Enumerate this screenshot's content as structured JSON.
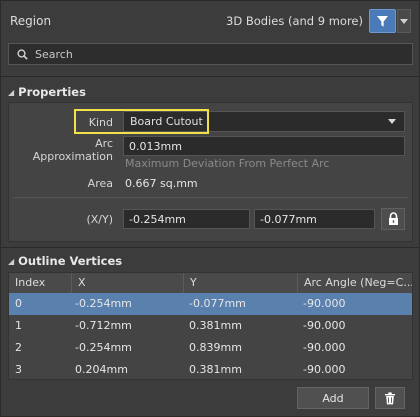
{
  "header": {
    "title": "Region",
    "filter_text": "3D Bodies (and 9 more)",
    "filter_icon": "funnel-icon",
    "filter_dropdown_icon": "chevron-down-icon"
  },
  "search": {
    "placeholder": "Search",
    "value": ""
  },
  "properties": {
    "section_title": "Properties",
    "kind_label": "Kind",
    "kind_value": "Board Cutout",
    "arc_label_line1": "Arc",
    "arc_label_line2": "Approximation",
    "arc_value": "0.013mm",
    "arc_hint": "Maximum Deviation From Perfect Arc",
    "area_label": "Area",
    "area_value": "0.667 sq.mm",
    "xy_label": "(X/Y)",
    "x_value": "-0.254mm",
    "y_value": "-0.077mm",
    "lock_icon": "lock-icon"
  },
  "outline": {
    "section_title": "Outline Vertices",
    "columns": [
      "Index",
      "X",
      "Y",
      "Arc Angle (Neg=C..."
    ],
    "rows": [
      {
        "index": "0",
        "x": "-0.254mm",
        "y": "-0.077mm",
        "arc": "-90.000",
        "selected": true
      },
      {
        "index": "1",
        "x": "-0.712mm",
        "y": "0.381mm",
        "arc": "-90.000",
        "selected": false
      },
      {
        "index": "2",
        "x": "-0.254mm",
        "y": "0.839mm",
        "arc": "-90.000",
        "selected": false
      },
      {
        "index": "3",
        "x": "0.204mm",
        "y": "0.381mm",
        "arc": "-90.000",
        "selected": false
      }
    ],
    "add_label": "Add",
    "delete_icon": "trash-icon"
  },
  "colors": {
    "background": "#3c3c3c",
    "accent": "#4a7bb8",
    "selected_row": "#5a80ae",
    "highlight": "#f2e24a"
  }
}
